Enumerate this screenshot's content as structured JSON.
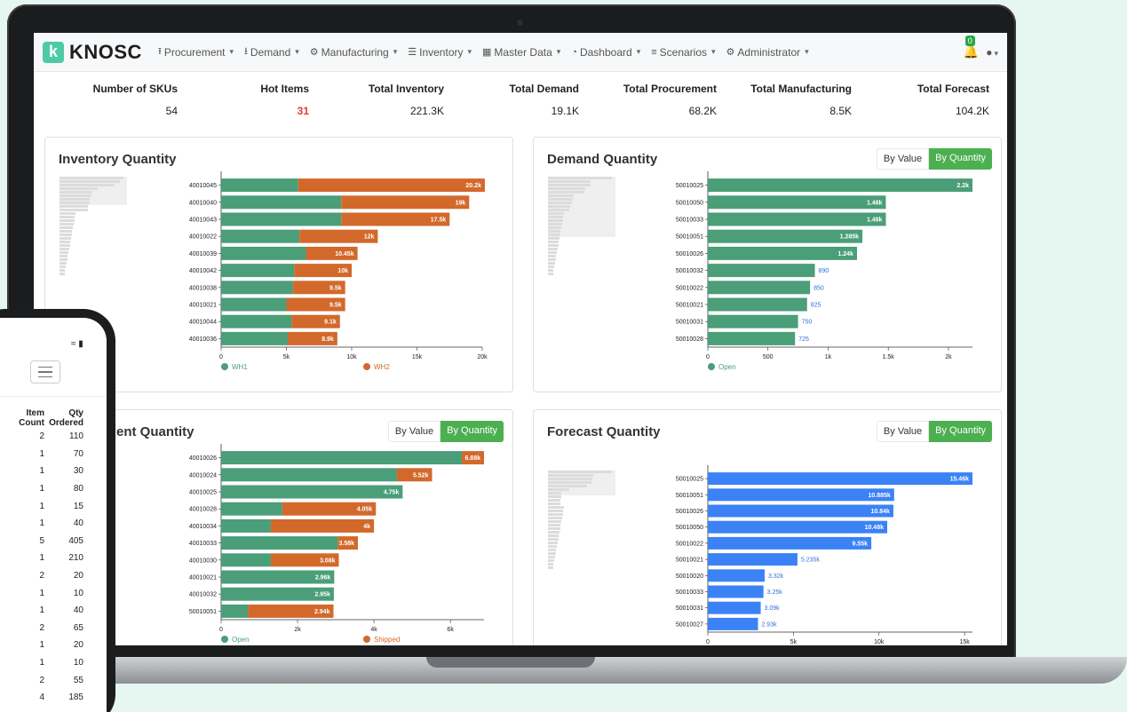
{
  "brand": {
    "name": "KNOSC",
    "mark": "k"
  },
  "nav": [
    {
      "label": "Procurement",
      "icon": "truck-load-icon"
    },
    {
      "label": "Demand",
      "icon": "truck-unload-icon"
    },
    {
      "label": "Manufacturing",
      "icon": "cogs-icon"
    },
    {
      "label": "Inventory",
      "icon": "list-icon"
    },
    {
      "label": "Master Data",
      "icon": "grid-icon"
    },
    {
      "label": "Dashboard",
      "icon": "dashboard-icon"
    },
    {
      "label": "Scenarios",
      "icon": "stack-icon"
    },
    {
      "label": "Administrator",
      "icon": "gear-icon"
    }
  ],
  "notifications": {
    "count": "0"
  },
  "kpis": [
    {
      "title": "Number of SKUs",
      "value": "54"
    },
    {
      "title": "Hot Items",
      "value": "31"
    },
    {
      "title": "Total Inventory",
      "value": "221.3K"
    },
    {
      "title": "Total Demand",
      "value": "19.1K"
    },
    {
      "title": "Total Procurement",
      "value": "68.2K"
    },
    {
      "title": "Total Manufacturing",
      "value": "8.5K"
    },
    {
      "title": "Total Forecast",
      "value": "104.2K"
    }
  ],
  "toggle": {
    "by_value": "By Value",
    "by_quantity": "By Quantity"
  },
  "colors": {
    "green": "#4a9e78",
    "orange": "#d2692b",
    "blue": "#3b82f6",
    "accent": "#4caf50"
  },
  "chart_data": [
    {
      "type": "bar",
      "title": "Inventory Quantity",
      "orientation": "horizontal",
      "stacked": true,
      "categories": [
        "40010045",
        "40010040",
        "40010043",
        "40010022",
        "40010039",
        "40010042",
        "40010038",
        "40010021",
        "40010044",
        "40010036"
      ],
      "series": [
        {
          "name": "WH1",
          "color": "#4a9e78",
          "values": [
            5900,
            9200,
            9200,
            6000,
            6500,
            5600,
            5500,
            5000,
            5400,
            5100
          ]
        },
        {
          "name": "WH2",
          "color": "#d2692b",
          "values": [
            14300,
            9800,
            8300,
            6000,
            3950,
            4400,
            4000,
            4500,
            3700,
            3800
          ]
        }
      ],
      "totals_labels": [
        "20.2k",
        "19k",
        "17.5k",
        "12k",
        "10.45k",
        "10k",
        "9.5k",
        "9.5k",
        "9.1k",
        "8.9k"
      ],
      "xticks": [
        "0",
        "5k",
        "10k",
        "15k",
        "20k"
      ],
      "xlim": [
        0,
        20000
      ],
      "legend": "bottom"
    },
    {
      "type": "bar",
      "title": "Demand Quantity",
      "orientation": "horizontal",
      "categories": [
        "50010025",
        "50010050",
        "50010033",
        "50010051",
        "50010026",
        "50010032",
        "50010022",
        "50010021",
        "50010031",
        "50010028"
      ],
      "series": [
        {
          "name": "Open",
          "color": "#4a9e78",
          "values": [
            2200,
            1480,
            1480,
            1285,
            1240,
            890,
            850,
            825,
            750,
            725
          ]
        }
      ],
      "value_labels": [
        "2.2k",
        "1.48k",
        "1.48k",
        "1.285k",
        "1.24k",
        "890",
        "850",
        "825",
        "750",
        "725"
      ],
      "xticks": [
        "0",
        "500",
        "1k",
        "1.5k",
        "2k"
      ],
      "xlim": [
        0,
        2200
      ],
      "legend": "bottom"
    },
    {
      "type": "bar",
      "title": "ent Quantity",
      "orientation": "horizontal",
      "stacked": true,
      "categories": [
        "40010026",
        "40010024",
        "40010025",
        "40010028",
        "40010034",
        "40010033",
        "40010030",
        "40010021",
        "40010032",
        "50010051"
      ],
      "series": [
        {
          "name": "Open",
          "color": "#4a9e78",
          "values": [
            6300,
            4600,
            4750,
            1600,
            1300,
            3050,
            1300,
            2960,
            2950,
            700
          ]
        },
        {
          "name": "Shipped",
          "color": "#d2692b",
          "values": [
            580,
            920,
            0,
            2450,
            2700,
            530,
            1780,
            0,
            0,
            2240
          ]
        }
      ],
      "totals_labels": [
        "6.88k",
        "5.52k",
        "4.75k",
        "4.05k",
        "4k",
        "3.58k",
        "3.08k",
        "2.96k",
        "2.95k",
        "2.94k"
      ],
      "xticks": [
        "0",
        "2k",
        "4k",
        "6k"
      ],
      "xlim": [
        0,
        6880
      ],
      "legend": "bottom"
    },
    {
      "type": "bar",
      "title": "Forecast Quantity",
      "orientation": "horizontal",
      "categories": [
        "50010025",
        "50010051",
        "50010026",
        "50010050",
        "50010022",
        "50010021",
        "50010020",
        "50010033",
        "50010031",
        "50010027"
      ],
      "series": [
        {
          "color": "#3b82f6",
          "values": [
            15460,
            10885,
            10840,
            10480,
            9550,
            5235,
            3320,
            3250,
            3090,
            2930
          ]
        }
      ],
      "value_labels": [
        "15.46k",
        "10.885k",
        "10.84k",
        "10.48k",
        "9.55k",
        "5.235k",
        "3.32k",
        "3.25k",
        "3.09k",
        "2.93k"
      ],
      "xticks": [
        "0",
        "5k",
        "10k",
        "15k"
      ],
      "xlim": [
        0,
        15460
      ]
    }
  ],
  "phone": {
    "headers": [
      "Item Count",
      "Qty Ordered"
    ],
    "header_line1": [
      "Item",
      "Qty"
    ],
    "header_line2": [
      "Count",
      "Ordered"
    ],
    "rows": [
      [
        "2",
        "110"
      ],
      [
        "1",
        "70"
      ],
      [
        "1",
        "30"
      ],
      [
        "1",
        "80"
      ],
      [
        "1",
        "15"
      ],
      [
        "1",
        "40"
      ],
      [
        "5",
        "405"
      ],
      [
        "1",
        "210"
      ],
      [
        "2",
        "20"
      ],
      [
        "1",
        "10"
      ],
      [
        "1",
        "40"
      ],
      [
        "2",
        "65"
      ],
      [
        "1",
        "20"
      ],
      [
        "1",
        "10"
      ],
      [
        "2",
        "55"
      ],
      [
        "4",
        "185"
      ]
    ]
  }
}
